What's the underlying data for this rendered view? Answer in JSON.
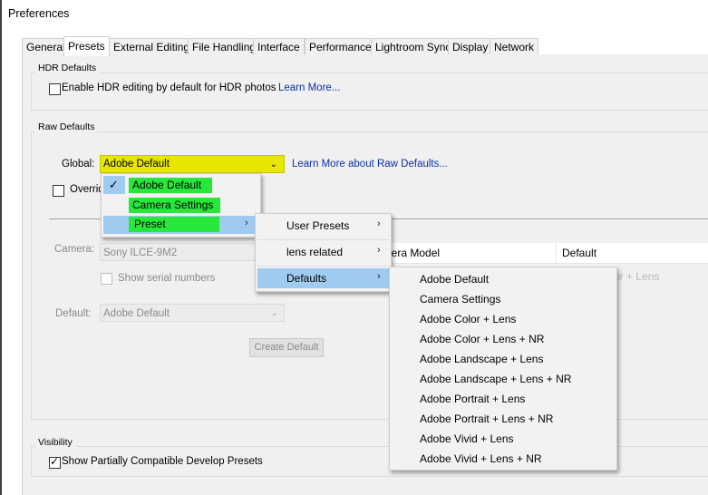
{
  "window": {
    "title": "Preferences"
  },
  "tabs": [
    {
      "label": "General"
    },
    {
      "label": "Presets"
    },
    {
      "label": "External Editing"
    },
    {
      "label": "File Handling"
    },
    {
      "label": "Interface"
    },
    {
      "label": "Performance"
    },
    {
      "label": "Lightroom Sync"
    },
    {
      "label": "Display"
    },
    {
      "label": "Network"
    }
  ],
  "active_tab": "Presets",
  "hdr": {
    "group_title": "HDR Defaults",
    "checkbox_label": "Enable HDR editing by default for HDR photos",
    "checked": false,
    "learn_more": "Learn More..."
  },
  "raw": {
    "group_title": "Raw Defaults",
    "global_label": "Global:",
    "global_value": "Adobe Default",
    "learn_more": "Learn More about Raw Defaults...",
    "override_label_partial": "Overrid",
    "camera_label": "Camera:",
    "camera_value": "Sony ILCE-9M2",
    "show_serial_label": "Show serial numbers",
    "default_label": "Default:",
    "default_value": "Adobe Default",
    "create_default_button": "Create Default",
    "table_header_camera_model_partial": "nera Model",
    "table_header_default": "Default",
    "table_row_partial": "or + Lens"
  },
  "visibility": {
    "group_title": "Visibility",
    "checkbox_label": "Show Partially Compatible Develop Presets",
    "checked": true
  },
  "menu1": {
    "items": [
      {
        "label": "Adobe Default",
        "checked": true
      },
      {
        "label": "Camera Settings",
        "checked": false
      },
      {
        "label": "Preset",
        "submenu": true
      }
    ]
  },
  "menu2": {
    "items": [
      {
        "label": "User Presets",
        "submenu": true
      },
      {
        "label": "lens related",
        "submenu": true
      },
      {
        "label": "Defaults",
        "submenu": true
      }
    ]
  },
  "menu3": {
    "items": [
      {
        "label": "Adobe Default"
      },
      {
        "label": "Camera Settings"
      },
      {
        "label": "Adobe Color + Lens"
      },
      {
        "label": "Adobe Color + Lens + NR"
      },
      {
        "label": "Adobe Landscape + Lens"
      },
      {
        "label": "Adobe Landscape + Lens + NR"
      },
      {
        "label": "Adobe Portrait + Lens"
      },
      {
        "label": "Adobe Portrait + Lens + NR"
      },
      {
        "label": "Adobe Vivid + Lens"
      },
      {
        "label": "Adobe Vivid + Lens + NR"
      }
    ]
  },
  "icons": {
    "check": "checkmark-icon",
    "submenu_arrow": "chevron-right-icon",
    "dropdown": "chevron-down-icon"
  },
  "colors": {
    "highlight_yellow": "#e6e600",
    "highlight_green": "#27e83a",
    "menu_selection_blue": "#9fcbf0",
    "link_blue": "#0b30a6"
  }
}
